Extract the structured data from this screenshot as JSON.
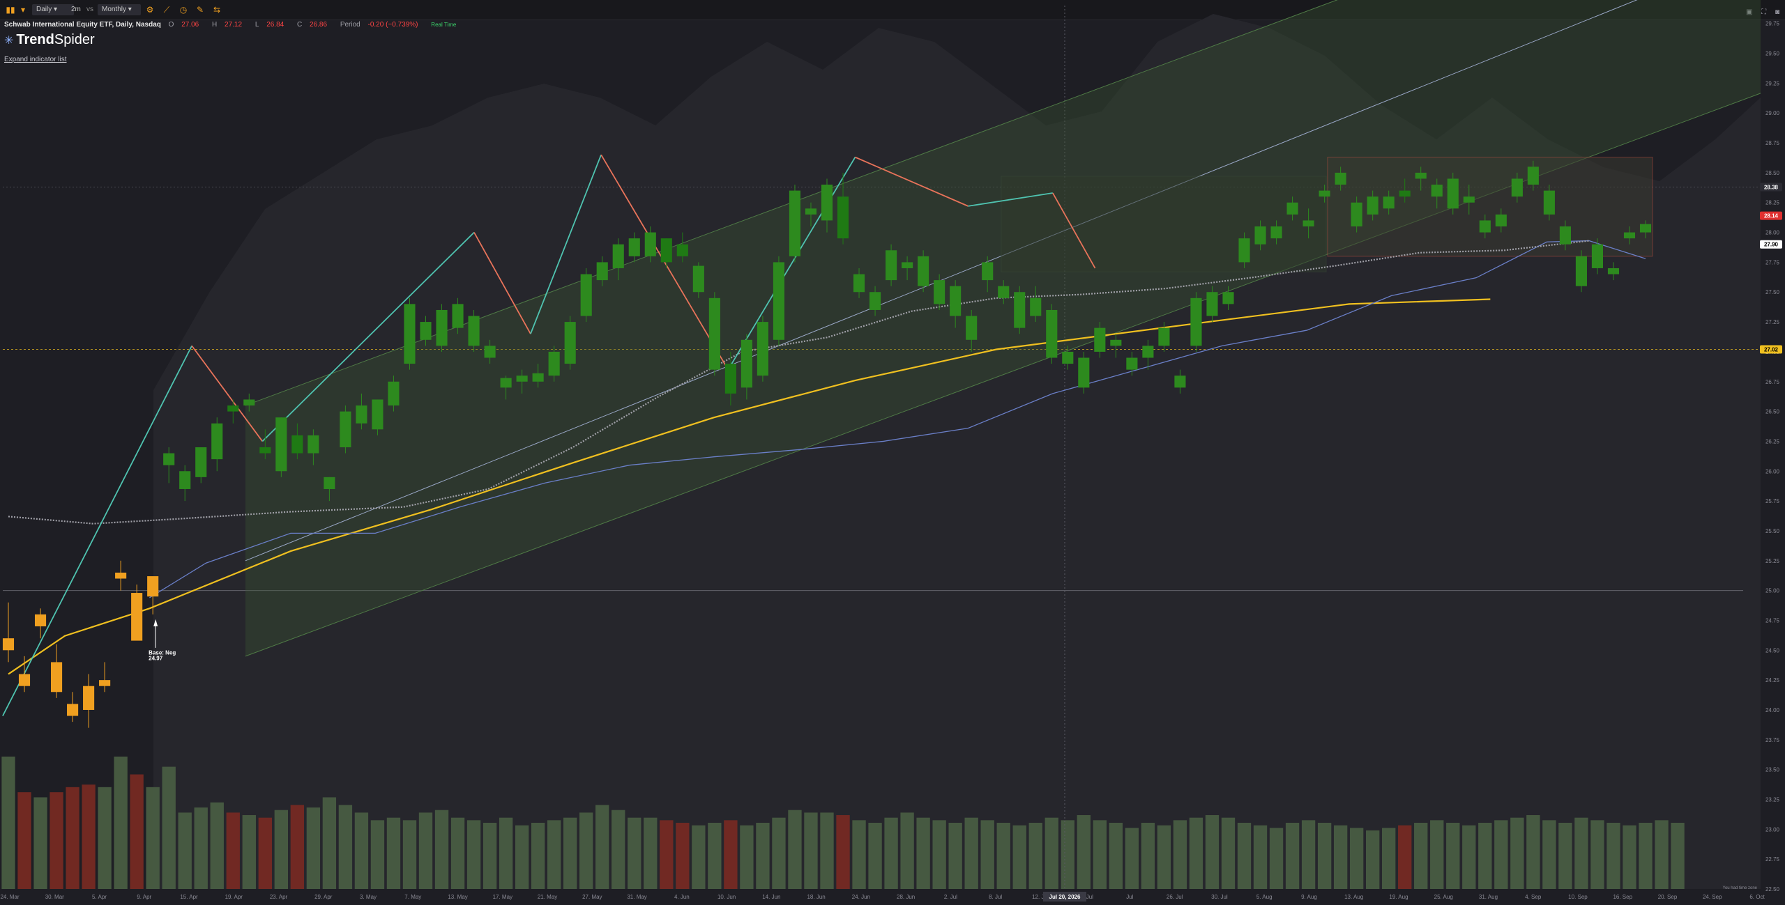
{
  "toolbar": {
    "timeframe": "Daily",
    "interval": "2m",
    "vs_label": "vs",
    "compare": "Monthly",
    "icons": [
      "candles-icon",
      "settings-icon",
      "indicator-icon",
      "clock-icon",
      "drawing-icon",
      "compare-icon"
    ]
  },
  "header": {
    "symbol": "Schwab International Equity ETF, Daily, Nasdaq",
    "open_label": "O",
    "open": "27.06",
    "high_label": "H",
    "high": "27.12",
    "low_label": "L",
    "low": "26.84",
    "close_label": "C",
    "close": "26.86",
    "period_label": "Period",
    "period_change": "-0.20 (−0.739%)",
    "status": "Real Time"
  },
  "logo": {
    "bold": "Trend",
    "regular": "Spider"
  },
  "expand_link": "Expand indicator list",
  "annotation": {
    "label": "Base: Neg",
    "value": "24.97"
  },
  "price_tags": [
    {
      "value": "28.38",
      "color": "#ffffff",
      "bg": "#2c2c34"
    },
    {
      "value": "28.14",
      "color": "#ffffff",
      "bg": "#e03030"
    },
    {
      "value": "27.90",
      "color": "#000000",
      "bg": "#ffffff"
    },
    {
      "value": "27.02",
      "color": "#000000",
      "bg": "#f0c020"
    }
  ],
  "crosshair_label": "Jul 20, 2026",
  "footer_note": "You had time zone",
  "colors": {
    "up": "#2d8a1e",
    "down_early": "#f0a020",
    "channel": "#3b5a34",
    "zigzag_up": "#4fc3b0",
    "zigzag_down": "#e8735a",
    "sma_long": "#f0c020",
    "sma_mid": "#6a7fc8",
    "dotted_ma": "#a0a0a8"
  },
  "chart_data": {
    "type": "candlestick",
    "title": "Schwab International Equity ETF, Daily, Nasdaq",
    "ylim": [
      22.5,
      29.9
    ],
    "y_ticks": [
      "29.75",
      "29.50",
      "29.25",
      "29.00",
      "28.75",
      "28.50",
      "28.25",
      "28.00",
      "27.75",
      "27.50",
      "27.25",
      "27.00",
      "26.75",
      "26.50",
      "26.25",
      "26.00",
      "25.75",
      "25.50",
      "25.25",
      "25.00",
      "24.75",
      "24.50",
      "24.25",
      "24.00",
      "23.75",
      "23.50",
      "23.25",
      "23.00",
      "22.75",
      "22.50"
    ],
    "x_ticks": [
      "24. Mar",
      "30. Mar",
      "5. Apr",
      "9. Apr",
      "15. Apr",
      "19. Apr",
      "23. Apr",
      "29. Apr",
      "3. May",
      "7. May",
      "13. May",
      "17. May",
      "21. May",
      "27. May",
      "31. May",
      "4. Jun",
      "10. Jun",
      "14. Jun",
      "18. Jun",
      "24. Jun",
      "28. Jun",
      "2. Jul",
      "8. Jul",
      "12. Jul",
      "16. Jul",
      "Jul",
      "26. Jul",
      "30. Jul",
      "5. Aug",
      "9. Aug",
      "13. Aug",
      "19. Aug",
      "25. Aug",
      "31. Aug",
      "4. Sep",
      "10. Sep",
      "16. Sep",
      "20. Sep",
      "24. Sep",
      "6. Oct"
    ],
    "candles": [
      {
        "o": 24.5,
        "h": 24.9,
        "l": 24.4,
        "c": 24.6
      },
      {
        "o": 24.3,
        "h": 24.45,
        "l": 24.15,
        "c": 24.2
      },
      {
        "o": 24.7,
        "h": 24.85,
        "l": 24.6,
        "c": 24.8
      },
      {
        "o": 24.4,
        "h": 24.55,
        "l": 24.1,
        "c": 24.15
      },
      {
        "o": 24.05,
        "h": 24.15,
        "l": 23.9,
        "c": 23.95
      },
      {
        "o": 24.2,
        "h": 24.3,
        "l": 23.85,
        "c": 24.0
      },
      {
        "o": 24.2,
        "h": 24.4,
        "l": 24.15,
        "c": 24.25
      },
      {
        "o": 25.1,
        "h": 25.25,
        "l": 25.0,
        "c": 25.15
      },
      {
        "o": 24.98,
        "h": 25.05,
        "l": 24.6,
        "c": 24.58
      },
      {
        "o": 24.95,
        "h": 25.1,
        "l": 24.8,
        "c": 25.12
      },
      {
        "o": 26.05,
        "h": 26.2,
        "l": 25.9,
        "c": 26.15
      },
      {
        "o": 25.85,
        "h": 26.05,
        "l": 25.75,
        "c": 26.0
      },
      {
        "o": 25.95,
        "h": 26.2,
        "l": 25.9,
        "c": 26.2
      },
      {
        "o": 26.1,
        "h": 26.45,
        "l": 26.0,
        "c": 26.4
      },
      {
        "o": 26.55,
        "h": 26.6,
        "l": 26.4,
        "c": 26.5
      },
      {
        "o": 26.55,
        "h": 26.65,
        "l": 26.5,
        "c": 26.6
      },
      {
        "o": 26.2,
        "h": 26.35,
        "l": 26.1,
        "c": 26.15
      },
      {
        "o": 26.0,
        "h": 26.45,
        "l": 25.95,
        "c": 26.45
      },
      {
        "o": 26.3,
        "h": 26.4,
        "l": 26.1,
        "c": 26.15
      },
      {
        "o": 26.15,
        "h": 26.35,
        "l": 26.05,
        "c": 26.3
      },
      {
        "o": 25.85,
        "h": 25.95,
        "l": 25.75,
        "c": 25.95
      },
      {
        "o": 26.2,
        "h": 26.55,
        "l": 26.15,
        "c": 26.5
      },
      {
        "o": 26.4,
        "h": 26.65,
        "l": 26.35,
        "c": 26.55
      },
      {
        "o": 26.35,
        "h": 26.6,
        "l": 26.3,
        "c": 26.6
      },
      {
        "o": 26.55,
        "h": 26.8,
        "l": 26.5,
        "c": 26.75
      },
      {
        "o": 26.9,
        "h": 27.45,
        "l": 26.85,
        "c": 27.4
      },
      {
        "o": 27.1,
        "h": 27.3,
        "l": 27.05,
        "c": 27.25
      },
      {
        "o": 27.05,
        "h": 27.4,
        "l": 27.0,
        "c": 27.35
      },
      {
        "o": 27.2,
        "h": 27.45,
        "l": 27.15,
        "c": 27.4
      },
      {
        "o": 27.05,
        "h": 27.35,
        "l": 27.0,
        "c": 27.3
      },
      {
        "o": 26.95,
        "h": 27.1,
        "l": 26.9,
        "c": 27.05
      },
      {
        "o": 26.7,
        "h": 26.8,
        "l": 26.6,
        "c": 26.78
      },
      {
        "o": 26.75,
        "h": 26.85,
        "l": 26.65,
        "c": 26.8
      },
      {
        "o": 26.75,
        "h": 26.9,
        "l": 26.7,
        "c": 26.82
      },
      {
        "o": 26.8,
        "h": 27.05,
        "l": 26.75,
        "c": 27.0
      },
      {
        "o": 26.9,
        "h": 27.3,
        "l": 26.85,
        "c": 27.25
      },
      {
        "o": 27.3,
        "h": 27.7,
        "l": 27.25,
        "c": 27.65
      },
      {
        "o": 27.6,
        "h": 27.8,
        "l": 27.55,
        "c": 27.75
      },
      {
        "o": 27.7,
        "h": 27.95,
        "l": 27.6,
        "c": 27.9
      },
      {
        "o": 27.8,
        "h": 28.0,
        "l": 27.75,
        "c": 27.95
      },
      {
        "o": 27.8,
        "h": 28.05,
        "l": 27.75,
        "c": 28.0
      },
      {
        "o": 27.95,
        "h": 27.95,
        "l": 27.7,
        "c": 27.75
      },
      {
        "o": 27.9,
        "h": 28.0,
        "l": 27.75,
        "c": 27.8
      },
      {
        "o": 27.5,
        "h": 27.75,
        "l": 27.45,
        "c": 27.72
      },
      {
        "o": 26.85,
        "h": 27.5,
        "l": 26.8,
        "c": 27.45
      },
      {
        "o": 26.9,
        "h": 27.0,
        "l": 26.55,
        "c": 26.65
      },
      {
        "o": 26.7,
        "h": 27.15,
        "l": 26.6,
        "c": 27.1
      },
      {
        "o": 26.8,
        "h": 27.3,
        "l": 26.75,
        "c": 27.25
      },
      {
        "o": 27.1,
        "h": 27.8,
        "l": 27.05,
        "c": 27.75
      },
      {
        "o": 27.8,
        "h": 28.4,
        "l": 27.75,
        "c": 28.35
      },
      {
        "o": 28.15,
        "h": 28.25,
        "l": 28.05,
        "c": 28.2
      },
      {
        "o": 28.1,
        "h": 28.45,
        "l": 28.0,
        "c": 28.4
      },
      {
        "o": 28.3,
        "h": 28.5,
        "l": 27.9,
        "c": 27.95
      },
      {
        "o": 27.5,
        "h": 27.7,
        "l": 27.45,
        "c": 27.65
      },
      {
        "o": 27.35,
        "h": 27.55,
        "l": 27.3,
        "c": 27.5
      },
      {
        "o": 27.6,
        "h": 27.9,
        "l": 27.55,
        "c": 27.85
      },
      {
        "o": 27.7,
        "h": 27.8,
        "l": 27.6,
        "c": 27.75
      },
      {
        "o": 27.55,
        "h": 27.85,
        "l": 27.5,
        "c": 27.8
      },
      {
        "o": 27.4,
        "h": 27.65,
        "l": 27.35,
        "c": 27.6
      },
      {
        "o": 27.3,
        "h": 27.6,
        "l": 27.2,
        "c": 27.55
      },
      {
        "o": 27.1,
        "h": 27.35,
        "l": 27.0,
        "c": 27.3
      },
      {
        "o": 27.6,
        "h": 27.8,
        "l": 27.5,
        "c": 27.75
      },
      {
        "o": 27.45,
        "h": 27.6,
        "l": 27.4,
        "c": 27.55
      },
      {
        "o": 27.2,
        "h": 27.55,
        "l": 27.15,
        "c": 27.5
      },
      {
        "o": 27.3,
        "h": 27.55,
        "l": 27.25,
        "c": 27.45
      },
      {
        "o": 26.95,
        "h": 27.4,
        "l": 26.9,
        "c": 27.35
      },
      {
        "o": 26.9,
        "h": 27.05,
        "l": 26.85,
        "c": 27.0
      },
      {
        "o": 26.7,
        "h": 27.0,
        "l": 26.65,
        "c": 26.95
      },
      {
        "o": 27.0,
        "h": 27.25,
        "l": 26.95,
        "c": 27.2
      },
      {
        "o": 27.05,
        "h": 27.15,
        "l": 26.95,
        "c": 27.1
      },
      {
        "o": 26.85,
        "h": 27.0,
        "l": 26.8,
        "c": 26.95
      },
      {
        "o": 26.95,
        "h": 27.1,
        "l": 26.85,
        "c": 27.05
      },
      {
        "o": 27.05,
        "h": 27.25,
        "l": 27.0,
        "c": 27.2
      },
      {
        "o": 26.7,
        "h": 26.85,
        "l": 26.65,
        "c": 26.8
      },
      {
        "o": 27.05,
        "h": 27.5,
        "l": 27.0,
        "c": 27.45
      },
      {
        "o": 27.3,
        "h": 27.55,
        "l": 27.25,
        "c": 27.5
      },
      {
        "o": 27.4,
        "h": 27.55,
        "l": 27.35,
        "c": 27.5
      },
      {
        "o": 27.75,
        "h": 28.0,
        "l": 27.7,
        "c": 27.95
      },
      {
        "o": 27.9,
        "h": 28.1,
        "l": 27.85,
        "c": 28.05
      },
      {
        "o": 27.95,
        "h": 28.1,
        "l": 27.9,
        "c": 28.05
      },
      {
        "o": 28.15,
        "h": 28.3,
        "l": 28.1,
        "c": 28.25
      },
      {
        "o": 28.05,
        "h": 28.2,
        "l": 27.95,
        "c": 28.1
      },
      {
        "o": 28.3,
        "h": 28.4,
        "l": 28.25,
        "c": 28.35
      },
      {
        "o": 28.4,
        "h": 28.55,
        "l": 28.35,
        "c": 28.5
      },
      {
        "o": 28.05,
        "h": 28.3,
        "l": 28.0,
        "c": 28.25
      },
      {
        "o": 28.15,
        "h": 28.35,
        "l": 28.1,
        "c": 28.3
      },
      {
        "o": 28.2,
        "h": 28.35,
        "l": 28.15,
        "c": 28.3
      },
      {
        "o": 28.35,
        "h": 28.45,
        "l": 28.25,
        "c": 28.3
      },
      {
        "o": 28.45,
        "h": 28.55,
        "l": 28.35,
        "c": 28.5
      },
      {
        "o": 28.3,
        "h": 28.45,
        "l": 28.2,
        "c": 28.4
      },
      {
        "o": 28.2,
        "h": 28.5,
        "l": 28.15,
        "c": 28.45
      },
      {
        "o": 28.25,
        "h": 28.4,
        "l": 28.15,
        "c": 28.3
      },
      {
        "o": 28.0,
        "h": 28.15,
        "l": 27.95,
        "c": 28.1
      },
      {
        "o": 28.05,
        "h": 28.2,
        "l": 28.0,
        "c": 28.15
      },
      {
        "o": 28.3,
        "h": 28.5,
        "l": 28.25,
        "c": 28.45
      },
      {
        "o": 28.4,
        "h": 28.6,
        "l": 28.35,
        "c": 28.55
      },
      {
        "o": 28.15,
        "h": 28.4,
        "l": 28.1,
        "c": 28.35
      },
      {
        "o": 27.9,
        "h": 28.1,
        "l": 27.85,
        "c": 28.05
      },
      {
        "o": 27.55,
        "h": 27.85,
        "l": 27.5,
        "c": 27.8
      },
      {
        "o": 27.7,
        "h": 27.95,
        "l": 27.65,
        "c": 27.9
      },
      {
        "o": 27.65,
        "h": 27.75,
        "l": 27.6,
        "c": 27.7
      },
      {
        "o": 27.95,
        "h": 28.05,
        "l": 27.9,
        "c": 28.0
      },
      {
        "o": 28.0,
        "h": 28.1,
        "l": 27.95,
        "c": 28.07
      }
    ],
    "sma_long": [
      [
        0,
        24.3
      ],
      [
        40,
        24.62
      ],
      [
        100,
        24.85
      ],
      [
        200,
        25.33
      ],
      [
        300,
        25.68
      ],
      [
        400,
        26.07
      ],
      [
        500,
        26.45
      ],
      [
        600,
        26.76
      ],
      [
        700,
        27.02
      ],
      [
        850,
        27.25
      ],
      [
        950,
        27.4
      ],
      [
        1050,
        27.44
      ]
    ],
    "sma_mid": [
      [
        100,
        24.94
      ],
      [
        140,
        25.23
      ],
      [
        200,
        25.48
      ],
      [
        260,
        25.48
      ],
      [
        320,
        25.7
      ],
      [
        380,
        25.9
      ],
      [
        440,
        26.05
      ],
      [
        500,
        26.12
      ],
      [
        560,
        26.18
      ],
      [
        620,
        26.25
      ],
      [
        680,
        26.36
      ],
      [
        740,
        26.65
      ],
      [
        800,
        26.85
      ],
      [
        860,
        27.05
      ],
      [
        920,
        27.18
      ],
      [
        980,
        27.47
      ],
      [
        1040,
        27.62
      ],
      [
        1090,
        27.92
      ],
      [
        1120,
        27.93
      ],
      [
        1160,
        27.78
      ]
    ],
    "dotted_ma": [
      [
        0,
        25.62
      ],
      [
        60,
        25.56
      ],
      [
        120,
        25.6
      ],
      [
        200,
        25.66
      ],
      [
        280,
        25.7
      ],
      [
        340,
        25.85
      ],
      [
        400,
        26.2
      ],
      [
        460,
        26.62
      ],
      [
        520,
        27.0
      ],
      [
        580,
        27.12
      ],
      [
        640,
        27.34
      ],
      [
        700,
        27.45
      ],
      [
        760,
        27.48
      ],
      [
        820,
        27.53
      ],
      [
        880,
        27.62
      ],
      [
        940,
        27.72
      ],
      [
        1000,
        27.83
      ],
      [
        1060,
        27.85
      ],
      [
        1120,
        27.93
      ]
    ],
    "zigzag": [
      [
        -4,
        23.95
      ],
      [
        130,
        27.05
      ],
      [
        180,
        26.25
      ],
      [
        330,
        28.0
      ],
      [
        370,
        27.15
      ],
      [
        420,
        28.65
      ],
      [
        510,
        26.85
      ],
      [
        600,
        28.63
      ],
      [
        680,
        28.22
      ],
      [
        740,
        28.33
      ],
      [
        770,
        27.7
      ]
    ],
    "volume": [
      0.52,
      0.38,
      0.36,
      0.38,
      0.4,
      0.41,
      0.4,
      0.52,
      0.45,
      0.4,
      0.48,
      0.3,
      0.32,
      0.34,
      0.3,
      0.29,
      0.28,
      0.31,
      0.33,
      0.32,
      0.36,
      0.33,
      0.3,
      0.27,
      0.28,
      0.27,
      0.3,
      0.31,
      0.28,
      0.27,
      0.26,
      0.28,
      0.25,
      0.26,
      0.27,
      0.28,
      0.3,
      0.33,
      0.31,
      0.28,
      0.28,
      0.27,
      0.26,
      0.25,
      0.26,
      0.27,
      0.25,
      0.26,
      0.28,
      0.31,
      0.3,
      0.3,
      0.29,
      0.27,
      0.26,
      0.28,
      0.3,
      0.28,
      0.27,
      0.26,
      0.28,
      0.27,
      0.26,
      0.25,
      0.26,
      0.28,
      0.27,
      0.29,
      0.27,
      0.26,
      0.24,
      0.26,
      0.25,
      0.27,
      0.28,
      0.29,
      0.28,
      0.26,
      0.25,
      0.24,
      0.26,
      0.27,
      0.26,
      0.25,
      0.24,
      0.23,
      0.24,
      0.25,
      0.26,
      0.27,
      0.26,
      0.25,
      0.26,
      0.27,
      0.28,
      0.29,
      0.27,
      0.26,
      0.28,
      0.27,
      0.26,
      0.25,
      0.26,
      0.27,
      0.26
    ]
  }
}
